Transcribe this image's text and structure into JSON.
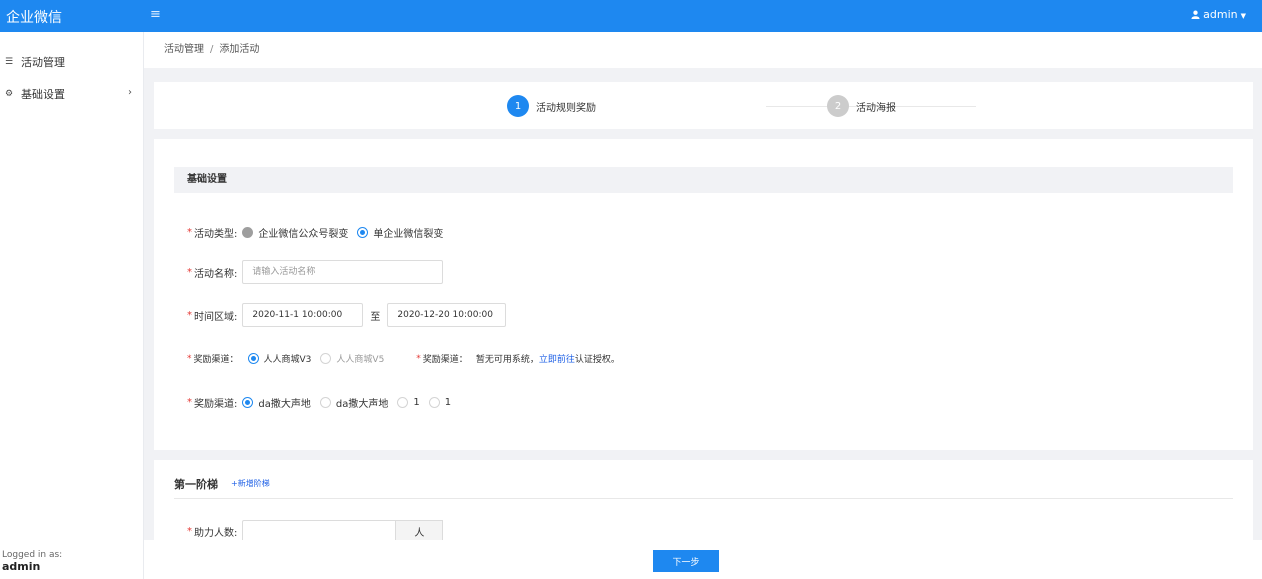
{
  "app": {
    "title": "企业微信",
    "menu_icon": "≡",
    "user": "admin",
    "user_icon": "user-icon"
  },
  "sidebar": {
    "items": [
      {
        "label": "活动管理",
        "icon": "list-icon"
      },
      {
        "label": "基础设置",
        "icon": "gears-icon",
        "arrow": "›"
      }
    ],
    "logged_in_label": "Logged in as:",
    "logged_in_user": "admin"
  },
  "breadcrumb": {
    "parent": "活动管理",
    "separator": "/",
    "current": "添加活动"
  },
  "steps": [
    {
      "number": "1",
      "label": "活动规则奖励",
      "state": "active"
    },
    {
      "number": "2",
      "label": "活动海报",
      "state": "inactive"
    }
  ],
  "basic": {
    "section_title": "基础设置",
    "activity_type": {
      "label": "活动类型:",
      "options": [
        "企业微信公众号裂变",
        "单企业微信裂变"
      ],
      "selected": "单企业微信裂变"
    },
    "activity_name": {
      "label": "活动名称:",
      "placeholder": "请输入活动名称",
      "value": ""
    },
    "time_range": {
      "label": "时间区域:",
      "start": "2020-11-1 10:00:00",
      "to": "至",
      "end": "2020-12-20 10:00:00"
    },
    "reward_channel_a": {
      "label": "奖励渠道：",
      "options": [
        "人人商城V3",
        "人人商城V5"
      ],
      "selected": "人人商城V3",
      "note_label": "奖励渠道：",
      "note_text": "暂无可用系统，",
      "note_link": "立即前往",
      "note_suffix": "认证授权。"
    },
    "reward_channel_b": {
      "label": "奖励渠道:",
      "options": [
        "da撒大声地",
        "da撒大声地",
        "1",
        "1"
      ],
      "selected": "da撒大声地"
    }
  },
  "tier": {
    "title": "第一阶梯",
    "add_link": "+新增阶梯",
    "helpers": {
      "label": "助力人数:",
      "value": "",
      "unit": "人"
    }
  },
  "footer": {
    "next_label": "下一步"
  },
  "colors": {
    "primary": "#1e88f0",
    "required": "#e53935",
    "link": "#1e60e6"
  }
}
